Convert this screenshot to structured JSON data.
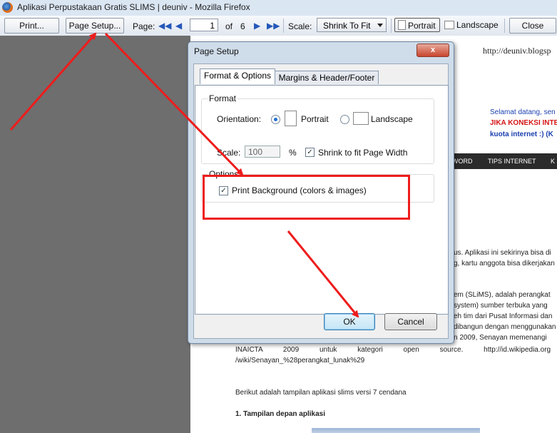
{
  "window": {
    "title": "Aplikasi Perpustakaan Gratis SLIMS | deuniv - Mozilla Firefox"
  },
  "toolbar": {
    "print_label": "Print...",
    "page_setup_label": "Page Setup...",
    "page_label": "Page:",
    "page_current": "1",
    "of_label": "of",
    "page_total": "6",
    "scale_label": "Scale:",
    "scale_value": "Shrink To Fit",
    "portrait_label": "Portrait",
    "landscape_label": "Landscape",
    "close_label": "Close"
  },
  "dialog": {
    "title": "Page Setup",
    "close_glyph": "x",
    "tabs": [
      "Format & Options",
      "Margins & Header/Footer"
    ],
    "format_group": "Format",
    "orientation_label": "Orientation:",
    "portrait_label": "Portrait",
    "landscape_label": "Landscape",
    "scale_label": "Scale:",
    "scale_value": "100",
    "percent_sign": "%",
    "shrink_label": "Shrink to fit Page Width",
    "options_group": "Options",
    "print_bg_label": "Print Background (colors & images)",
    "ok_label": "OK",
    "cancel_label": "Cancel"
  },
  "preview": {
    "url_text": "http://deuniv.blogsp",
    "welcome_1": "Selamat datang, sen",
    "welcome_2": "JIKA KONEKSI INTE",
    "welcome_3": "kuota internet :) (K",
    "nav_items": [
      "WORD",
      "TIPS INTERNET",
      "K"
    ],
    "para_1a": "us. Aplikasi ini sekirinya bisa di",
    "para_1b": "g, kartu anggota bisa dikerjakan",
    "para_2a": "em (SLiMS), adalah perangkat",
    "para_2b": "system) sumber terbuka yang",
    "para_2c": "eh tim dari Pusat Informasi dan",
    "para_2d": "dibangun dengan menggunakan",
    "para_2e": "n 2009, Senayan memenangi",
    "para_2f": "INAICTA 2009 untuk kategori open source. http://id.wikipedia.org",
    "para_2g": "/wiki/Senayan_%28perangkat_lunak%29",
    "para_3": "Berikut adalah tampilan aplikasi slims versi 7 cendana",
    "heading_1": "1. Tampilan depan aplikasi"
  },
  "colors": {
    "annotation": "#ee1c1c",
    "accent": "#1f6fd1"
  }
}
